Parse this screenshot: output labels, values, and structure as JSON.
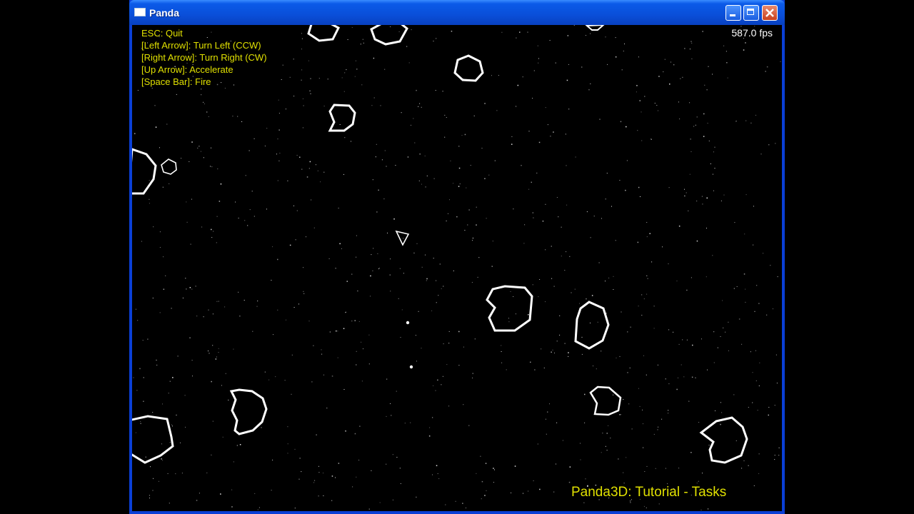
{
  "window": {
    "title": "Panda"
  },
  "hud": {
    "help_lines": [
      "ESC: Quit",
      "[Left Arrow]: Turn Left (CCW)",
      "[Right Arrow]: Turn Right (CW)",
      "[Up Arrow]: Accelerate",
      "[Space Bar]: Fire"
    ],
    "fps": "587.0 fps",
    "caption": "Panda3D: Tutorial - Tasks"
  },
  "colors": {
    "hud_text": "#e0e000",
    "asteroid": "#ffffff",
    "background": "#000000",
    "titlebar": "#0a4fd9"
  },
  "icons": {
    "window": "window-icon",
    "minimize": "minimize-icon",
    "maximize": "maximize-icon",
    "close": "close-icon"
  }
}
